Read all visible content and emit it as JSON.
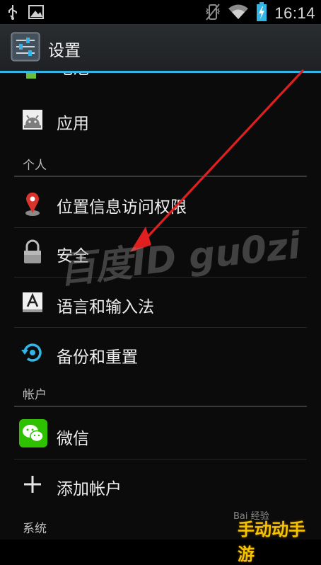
{
  "status_bar": {
    "time": "16:14",
    "left_icons": [
      "usb-icon",
      "screenshot-icon"
    ],
    "right_icons": [
      "vibrate-icon",
      "wifi-icon",
      "battery-charging-icon"
    ]
  },
  "action_bar": {
    "title": "设置",
    "icon": "settings-sliders-icon"
  },
  "list": {
    "partial_item": {
      "label": "电池",
      "icon": "battery-icon"
    },
    "apps_item": {
      "label": "应用",
      "icon": "android-apps-icon"
    },
    "section_personal": "个人",
    "personal_items": [
      {
        "label": "位置信息访问权限",
        "icon": "location-pin-icon"
      },
      {
        "label": "安全",
        "icon": "lock-icon"
      },
      {
        "label": "语言和输入法",
        "icon": "keyboard-a-icon"
      },
      {
        "label": "备份和重置",
        "icon": "backup-restore-icon"
      }
    ],
    "section_accounts": "帐户",
    "account_items": [
      {
        "label": "微信",
        "icon": "wechat-icon"
      },
      {
        "label": "添加帐户",
        "icon": "add-plus-icon"
      }
    ],
    "section_system": "系统"
  },
  "overlays": {
    "watermark": "百度ID  gu0zi",
    "corner_watermark": "手动动手游",
    "baidu_mark": "Bai 经验"
  },
  "colors": {
    "accent": "#33b5e5",
    "arrow": "#e02020",
    "wechat": "#2dc100",
    "location_pin": "#d9342b"
  }
}
